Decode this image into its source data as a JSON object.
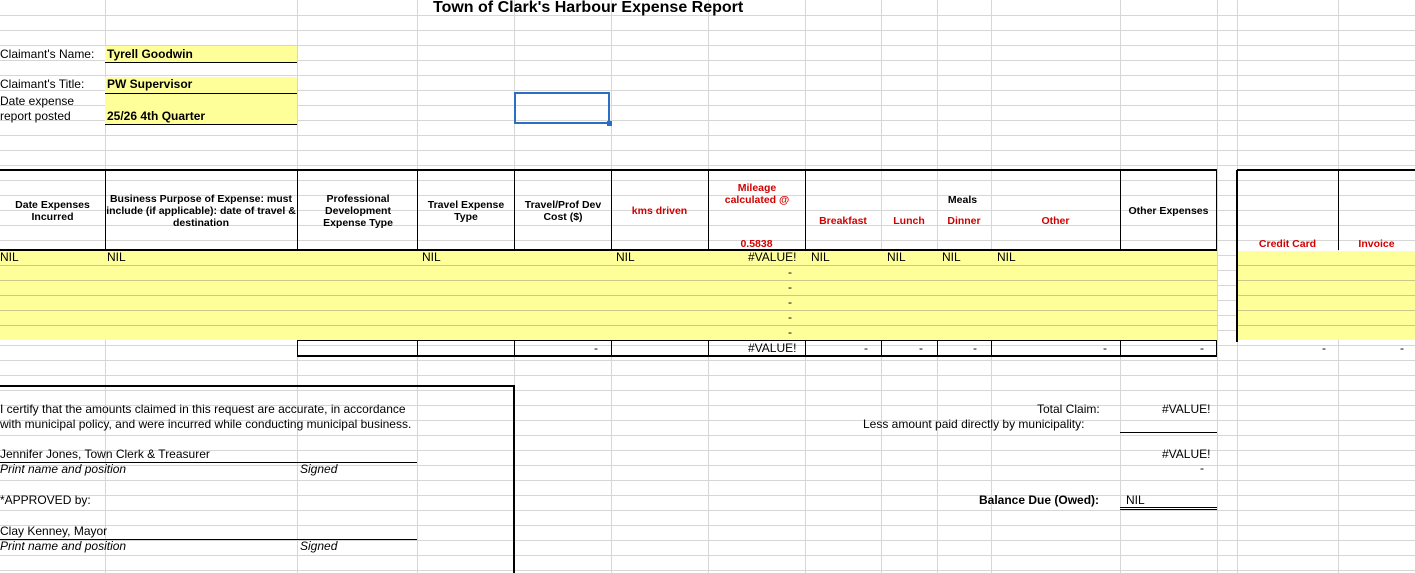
{
  "title": "Town of Clark's Harbour Expense Report",
  "claimant": {
    "name_label": "Claimant's Name:",
    "name_value": "Tyrell Goodwin",
    "title_label": "Claimant's Title:",
    "title_value": "PW Supervisor",
    "date_label_1": "Date expense",
    "date_label_2": "report posted",
    "date_value": "25/26 4th Quarter"
  },
  "table": {
    "headers": {
      "date": "Date Expenses Incurred",
      "purpose": "Business Purpose of Expense: must include (if applicable): date of travel & destination",
      "pd_type": "Professional Development Expense Type",
      "travel_type": "Travel Expense Type",
      "travel_cost": "Travel/Prof Dev Cost ($)",
      "kms": "kms driven",
      "mileage": "Mileage calculated @",
      "mileage_rate": "0.5838",
      "meals": "Meals",
      "breakfast": "Breakfast",
      "lunch": "Lunch",
      "dinner": "Dinner",
      "other": "Other",
      "other_expenses": "Other Expenses",
      "credit_card": "Credit Card",
      "invoice": "Invoice"
    },
    "first_row": {
      "date": "NIL",
      "purpose": "NIL",
      "travel_type": "NIL",
      "kms": "NIL",
      "mileage": "#VALUE!",
      "breakfast": "NIL",
      "lunch": "NIL",
      "dinner": "NIL",
      "other": "NIL"
    },
    "dash": "-",
    "totals": {
      "travel_cost": "-",
      "mileage": "#VALUE!",
      "breakfast": "-",
      "lunch": "-",
      "dinner": "-",
      "other": "-",
      "other_expenses": "-",
      "credit_card": "-",
      "invoice": "-"
    }
  },
  "certification": {
    "line1": "I certify that the amounts claimed in this request are accurate, in accordance",
    "line2": "with municipal policy, and were incurred while conducting municipal business.",
    "signer1": "Jennifer Jones, Town Clerk & Treasurer",
    "print_label": "Print name and position",
    "signed_label": "Signed",
    "approved_label": "*APPROVED by:",
    "signer2": "Clay Kenney, Mayor"
  },
  "summary": {
    "total_claim_label": "Total Claim:",
    "total_claim_value": "#VALUE!",
    "less_label": "Less amount paid directly by municipality:",
    "subtotal_value": "#VALUE!",
    "subtotal_dash": "-",
    "balance_label": "Balance Due (Owed):",
    "balance_value": "NIL"
  },
  "colors": {
    "highlight": "#ffff9a",
    "red_text": "#d10000",
    "selection": "#2a6fc3"
  }
}
